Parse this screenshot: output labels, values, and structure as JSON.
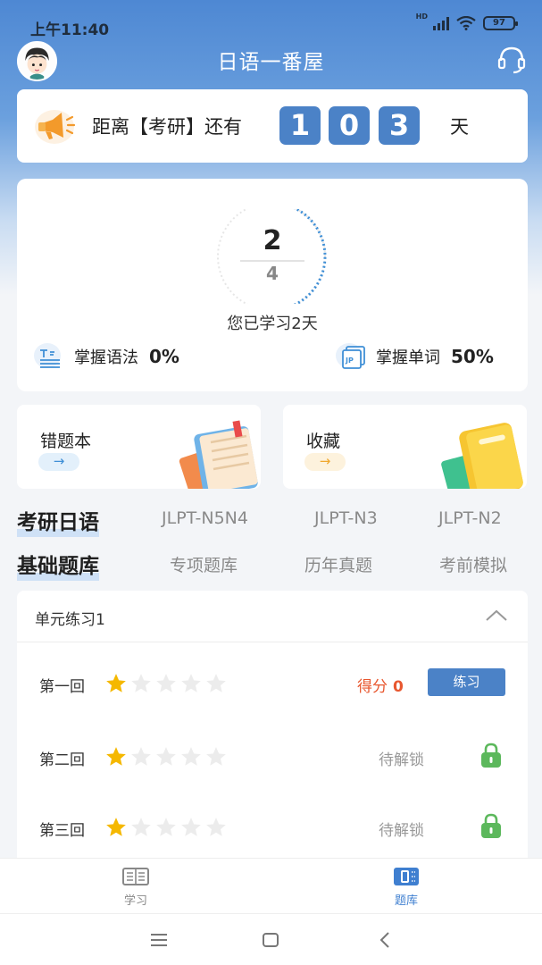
{
  "status_bar": {
    "time": "上午11:40",
    "network": "HD",
    "battery": "97"
  },
  "header": {
    "title": "日语一番屋"
  },
  "countdown": {
    "prefix": "距离【考研】还有",
    "digits": [
      "1",
      "0",
      "3"
    ],
    "suffix": "天"
  },
  "progress": {
    "current": "2",
    "total": "4",
    "ring_progress": 0.5,
    "study_days_text": "您已学习2天",
    "grammar_label": "掌握语法",
    "grammar_pct": "0%",
    "words_label": "掌握单词",
    "words_pct": "50%",
    "words_icon_text": "JP"
  },
  "shortcuts": [
    {
      "label": "错题本",
      "arrow": "→"
    },
    {
      "label": "收藏",
      "arrow": "→"
    }
  ],
  "level_tabs": [
    "考研日语",
    "JLPT-N5N4",
    "JLPT-N3",
    "JLPT-N2"
  ],
  "bank_tabs": [
    "基础题库",
    "专项题库",
    "历年真题",
    "考前模拟"
  ],
  "unit": {
    "title": "单元练习1",
    "rounds": [
      {
        "name": "第一回",
        "stars_filled": 1,
        "stars_total": 5,
        "score_label": "得分",
        "score_value": "0",
        "action": "练习"
      },
      {
        "name": "第二回",
        "stars_filled": 1,
        "stars_total": 5,
        "status": "待解锁"
      },
      {
        "name": "第三回",
        "stars_filled": 1,
        "stars_total": 5,
        "status": "待解锁"
      }
    ]
  },
  "bottom_nav": [
    {
      "label": "学习",
      "active": false
    },
    {
      "label": "题库",
      "active": true
    }
  ],
  "colors": {
    "accent": "#4b82c7",
    "score": "#e8572f",
    "lock": "#5cb85c",
    "star": "#f5b800"
  }
}
